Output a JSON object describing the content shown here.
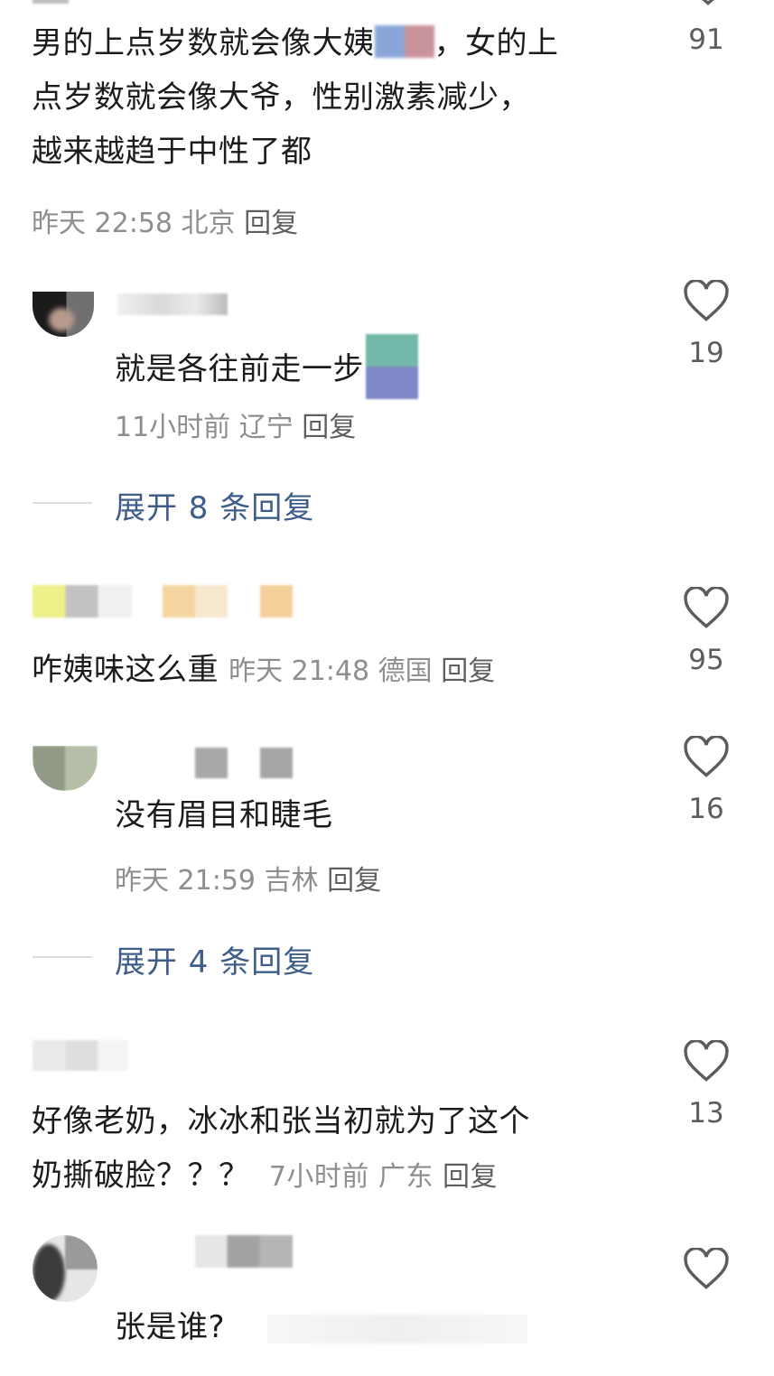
{
  "comments": [
    {
      "text_lines": [
        "男的上点岁数就会像大姨",
        "，女的上",
        "点岁数就会像大爷，性别激素减少，",
        "越来越趋于中性了都"
      ],
      "time": "昨天 22:58",
      "location": "北京",
      "reply": "回复",
      "likes": "91"
    },
    {
      "text": "就是各往前走一步",
      "time": "11小时前",
      "location": "辽宁",
      "reply": "回复",
      "likes": "19",
      "expand": "展开 8 条回复"
    },
    {
      "text": "咋姨味这么重",
      "time": "昨天 21:48",
      "location": "德国",
      "reply": "回复",
      "likes": "95"
    },
    {
      "text": "没有眉目和睫毛",
      "time": "昨天 21:59",
      "location": "吉林",
      "reply": "回复",
      "likes": "16",
      "expand": "展开 4 条回复"
    },
    {
      "text_lines": [
        "好像老奶，冰冰和张当初就为了这个",
        "奶撕破脸？？？"
      ],
      "time": "7小时前",
      "location": "广东",
      "reply": "回复",
      "likes": "13"
    },
    {
      "text": "张是谁?",
      "likes": ""
    }
  ],
  "icons": {
    "like": "heart-outline-icon"
  },
  "colors": {
    "text": "#1c1c1c",
    "meta": "#8e8e8e",
    "expand": "#3e5d88",
    "icon": "#5c5c5c"
  }
}
